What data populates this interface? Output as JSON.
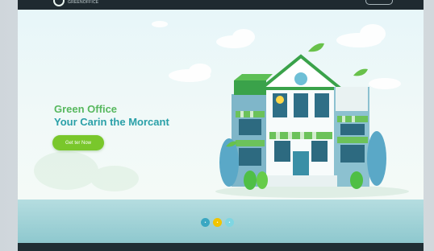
{
  "header": {
    "logo_icon": "leaf-circle-icon",
    "logo_text": "GREENOFFICE"
  },
  "hero": {
    "title_line1": "Green Office",
    "title_line2": "Your Carin the Morcant",
    "cta_label": "Get ter Now"
  },
  "carousel": {
    "dots": [
      {
        "label": "•",
        "color": "#3aa7c2"
      },
      {
        "label": "•",
        "color": "#f2c400"
      },
      {
        "label": "•",
        "color": "#7fd6e2"
      }
    ]
  },
  "colors": {
    "accent_green": "#79c72b",
    "title_teal": "#2aa0a8",
    "title_green": "#57b85e",
    "topbar_dark": "#1f2a30"
  }
}
